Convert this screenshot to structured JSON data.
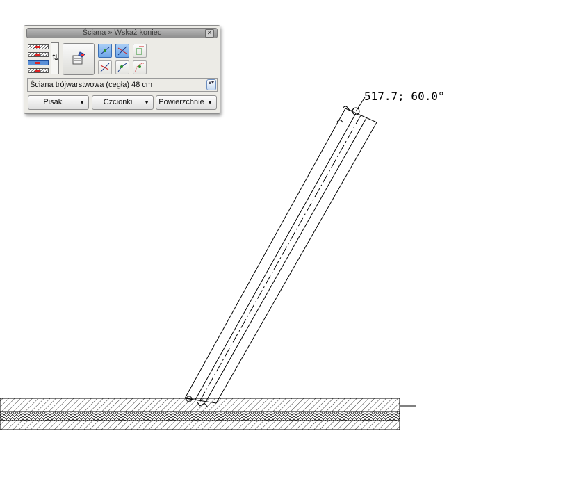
{
  "panel": {
    "title": "Ściana » Wskaż koniec",
    "close_glyph": "✕",
    "arrow_glyph": "⇅",
    "wall_type": "Ściana trójwarstwowa (cegła) 48 cm",
    "spin_glyph": "▴▾",
    "dropdowns": [
      {
        "label": "Pisaki"
      },
      {
        "label": "Czcionki"
      },
      {
        "label": "Powierzchnie"
      }
    ],
    "caret": "▼"
  },
  "drawing": {
    "readout": "517.7;  60.0°",
    "colors": {
      "line": "#000000",
      "hatch": "#000000"
    }
  }
}
